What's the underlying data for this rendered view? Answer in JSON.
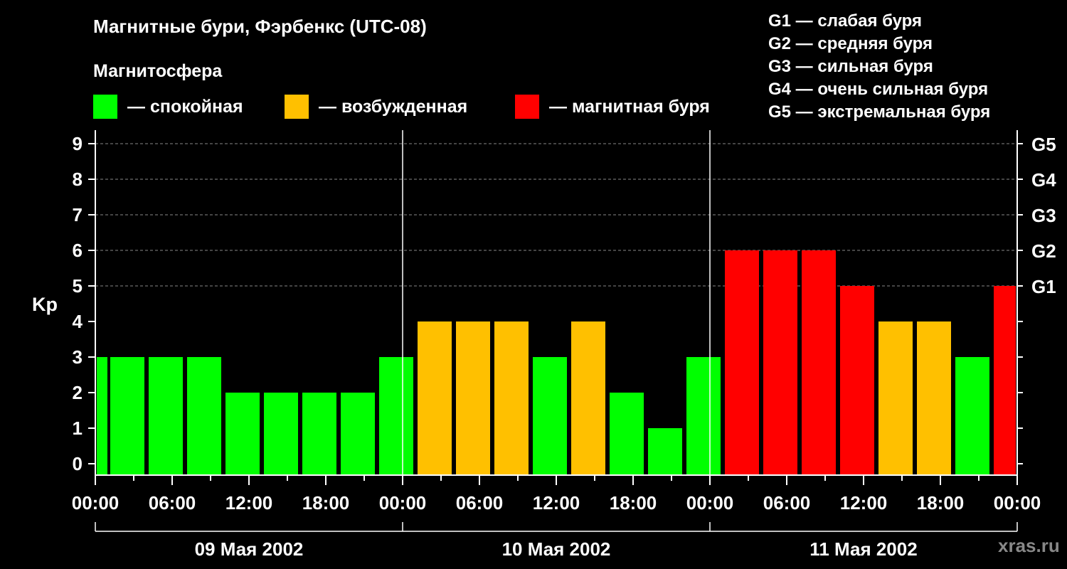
{
  "title": "Магнитные бури, Фэрбенкс (UTC-08)",
  "legend": {
    "title": "Магнитосфера",
    "items": [
      {
        "label": "— спокойная",
        "color": "#00ff00"
      },
      {
        "label": "— возбужденная",
        "color": "#ffc000"
      },
      {
        "label": "— магнитная буря",
        "color": "#ff0000"
      }
    ]
  },
  "storm_scale": [
    "G1 — слабая буря",
    "G2 — средняя буря",
    "G3 — сильная буря",
    "G4 — очень сильная буря",
    "G5 — экстремальная буря"
  ],
  "watermark": "xras.ru",
  "chart_data": {
    "type": "bar",
    "ylabel": "Kp",
    "ylim": [
      0,
      9
    ],
    "yticks": [
      "0",
      "1",
      "2",
      "3",
      "4",
      "5",
      "6",
      "7",
      "8",
      "9"
    ],
    "right_axis_labels": [
      {
        "level": 5,
        "label": "G1"
      },
      {
        "level": 6,
        "label": "G2"
      },
      {
        "level": 7,
        "label": "G3"
      },
      {
        "level": 8,
        "label": "G4"
      },
      {
        "level": 9,
        "label": "G5"
      }
    ],
    "x_tick_labels": [
      "00:00",
      "06:00",
      "12:00",
      "18:00",
      "00:00",
      "06:00",
      "12:00",
      "18:00",
      "00:00",
      "06:00",
      "12:00",
      "18:00",
      "00:00"
    ],
    "days": [
      "09 Мая 2002",
      "10 Мая 2002",
      "11 Мая 2002"
    ],
    "grid": true,
    "colors": {
      "quiet": "#00ff00",
      "active": "#ffc000",
      "storm": "#ff0000"
    },
    "bars": [
      {
        "start_hour": 0,
        "value": 3,
        "level": "quiet",
        "partial": true
      },
      {
        "start_hour": 1,
        "value": 3,
        "level": "quiet"
      },
      {
        "start_hour": 4,
        "value": 3,
        "level": "quiet"
      },
      {
        "start_hour": 7,
        "value": 3,
        "level": "quiet"
      },
      {
        "start_hour": 10,
        "value": 2,
        "level": "quiet"
      },
      {
        "start_hour": 13,
        "value": 2,
        "level": "quiet"
      },
      {
        "start_hour": 16,
        "value": 2,
        "level": "quiet"
      },
      {
        "start_hour": 19,
        "value": 2,
        "level": "quiet"
      },
      {
        "start_hour": 22,
        "value": 3,
        "level": "quiet"
      },
      {
        "start_hour": 25,
        "value": 4,
        "level": "active"
      },
      {
        "start_hour": 28,
        "value": 4,
        "level": "active"
      },
      {
        "start_hour": 31,
        "value": 4,
        "level": "active"
      },
      {
        "start_hour": 34,
        "value": 3,
        "level": "quiet"
      },
      {
        "start_hour": 37,
        "value": 4,
        "level": "active"
      },
      {
        "start_hour": 40,
        "value": 2,
        "level": "quiet"
      },
      {
        "start_hour": 43,
        "value": 1,
        "level": "quiet"
      },
      {
        "start_hour": 46,
        "value": 3,
        "level": "quiet"
      },
      {
        "start_hour": 49,
        "value": 6,
        "level": "storm"
      },
      {
        "start_hour": 52,
        "value": 6,
        "level": "storm"
      },
      {
        "start_hour": 55,
        "value": 6,
        "level": "storm"
      },
      {
        "start_hour": 58,
        "value": 5,
        "level": "storm"
      },
      {
        "start_hour": 61,
        "value": 4,
        "level": "active"
      },
      {
        "start_hour": 64,
        "value": 4,
        "level": "active"
      },
      {
        "start_hour": 67,
        "value": 3,
        "level": "quiet"
      },
      {
        "start_hour": 70,
        "value": 5,
        "level": "storm",
        "partial": true
      }
    ]
  }
}
